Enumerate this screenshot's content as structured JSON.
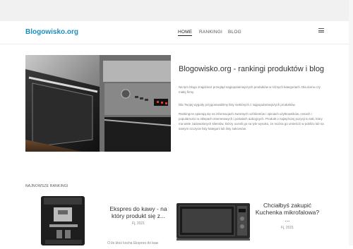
{
  "site": {
    "logo": "Blogowisko.org"
  },
  "nav": {
    "items": [
      "HOME",
      "RANKINGI",
      "BLOG"
    ]
  },
  "hero": {
    "title": "Blogowisko.org - rankingi produktów i blog",
    "paragraphs": [
      "Na tym blogu znajdziesz przegląd najpopularniejszych produktów w różnych kategoriach. Dla domu czy małej firmy.",
      "Dla Twojej wygody przygotowaliśmy listy niektórych z najpopularniejszych produktów.",
      "Rankingi te opierają się na informacjach zwrotnych od klientów i opiniach użytkowników, cenach i popularności w sklepach internetowych i portalach aukcyjnych. Produkt o najwyższej pozycji to taki, który ma wiele zadowolonych klientów, którzy ocenili go na tyle wysoko, że można go umieścić w pobliżu lub na samym szczycie listy kategorii lub listy sukcesów."
    ]
  },
  "section": {
    "label": "NAJNOWSZE RANKINGI"
  },
  "cards": [
    {
      "title": "Ekspres do kawy - na który produkt się z...",
      "date": "Fj, 2021",
      "excerpt": "O ile ktoś kocha Ekspres do kaw"
    },
    {
      "title": "Chciałbyś zakupić Kuchenka mikrofalowa? ...",
      "date": "Fj, 2021"
    }
  ],
  "colors": {
    "brand": "#1b8dbd"
  }
}
